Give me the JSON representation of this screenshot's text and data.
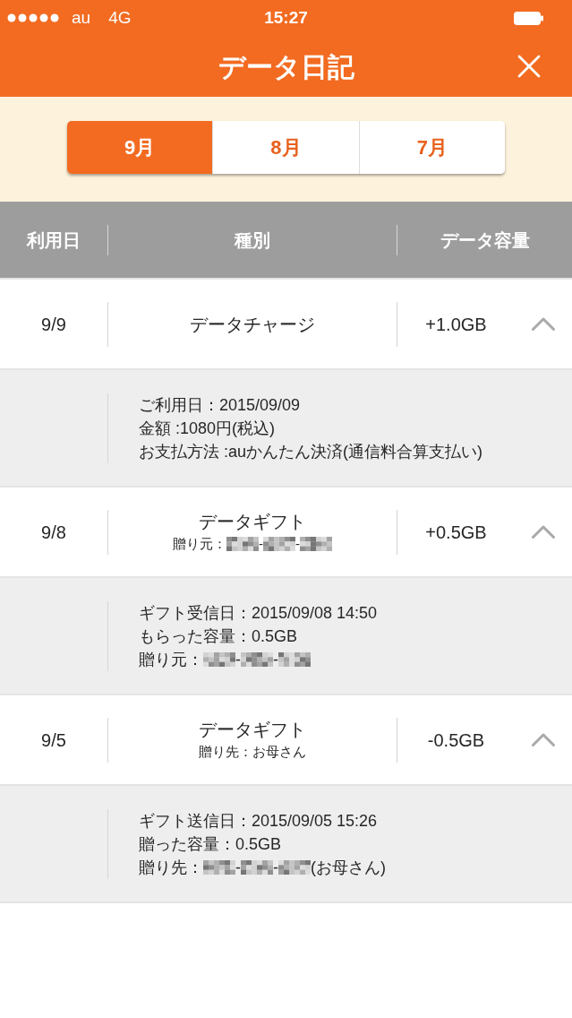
{
  "status_bar": {
    "carrier": "au",
    "network": "4G",
    "time": "15:27"
  },
  "nav_bar": {
    "title": "データ日記"
  },
  "month_tabs": [
    {
      "label": "9月",
      "selected": true
    },
    {
      "label": "8月",
      "selected": false
    },
    {
      "label": "7月",
      "selected": false
    }
  ],
  "table": {
    "columns": [
      "利用日",
      "種別",
      "データ容量"
    ],
    "rows": [
      {
        "date": "9/9",
        "type": "データチャージ",
        "amount": "+1.0GB",
        "expanded": true,
        "details": [
          [
            {
              "kind": "text",
              "text": "ご利用日：2015/09/09"
            }
          ],
          [
            {
              "kind": "text",
              "text": "金額 :1080円(税込)"
            }
          ],
          [
            {
              "kind": "text",
              "text": "お支払方法 :auかんたん決済(通信料合算支払い)"
            }
          ]
        ]
      },
      {
        "date": "9/8",
        "type": "データギフト",
        "sub": [
          {
            "kind": "text",
            "text": "贈り元："
          },
          {
            "kind": "mosaic"
          },
          {
            "kind": "text",
            "text": "-"
          },
          {
            "kind": "mosaic"
          },
          {
            "kind": "text",
            "text": "-"
          },
          {
            "kind": "mosaic"
          }
        ],
        "amount": "+0.5GB",
        "expanded": true,
        "details": [
          [
            {
              "kind": "text",
              "text": "ギフト受信日：2015/09/08 14:50"
            }
          ],
          [
            {
              "kind": "text",
              "text": "もらった容量：0.5GB"
            }
          ],
          [
            {
              "kind": "text",
              "text": "贈り元："
            },
            {
              "kind": "mosaic"
            },
            {
              "kind": "text",
              "text": "-"
            },
            {
              "kind": "mosaic"
            },
            {
              "kind": "text",
              "text": "-"
            },
            {
              "kind": "mosaic"
            }
          ]
        ]
      },
      {
        "date": "9/5",
        "type": "データギフト",
        "sub": [
          {
            "kind": "text",
            "text": "贈り先：お母さん"
          }
        ],
        "amount": "-0.5GB",
        "expanded": true,
        "details": [
          [
            {
              "kind": "text",
              "text": "ギフト送信日：2015/09/05 15:26"
            }
          ],
          [
            {
              "kind": "text",
              "text": "贈った容量：0.5GB"
            }
          ],
          [
            {
              "kind": "text",
              "text": "贈り先："
            },
            {
              "kind": "mosaic"
            },
            {
              "kind": "text",
              "text": "-"
            },
            {
              "kind": "mosaic"
            },
            {
              "kind": "text",
              "text": "-"
            },
            {
              "kind": "mosaic"
            },
            {
              "kind": "text",
              "text": "(お母さん)"
            }
          ]
        ]
      }
    ]
  }
}
